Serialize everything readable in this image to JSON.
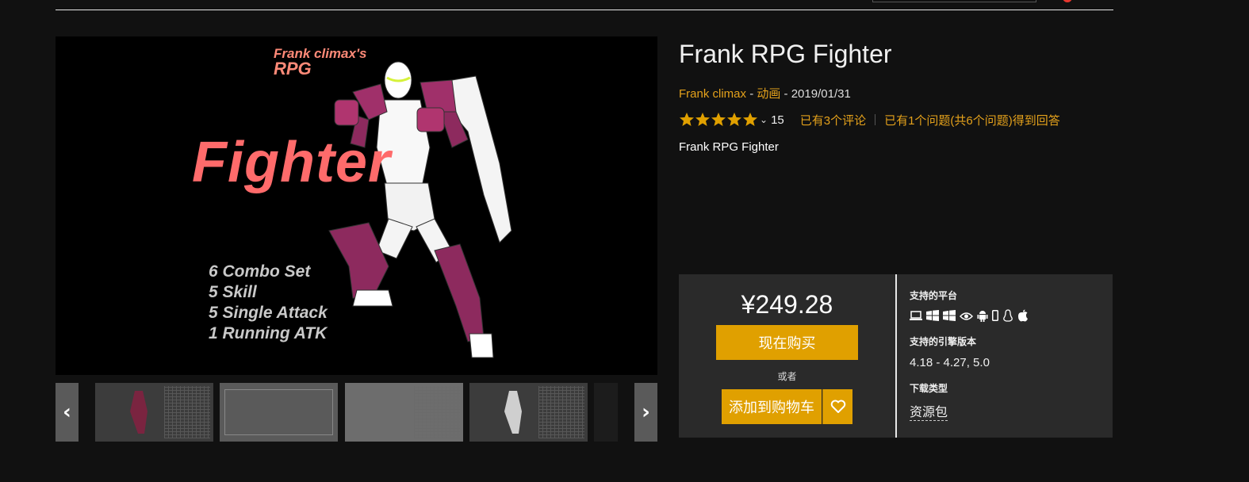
{
  "product": {
    "title": "Frank RPG Fighter",
    "author": "Frank climax",
    "category": "动画",
    "date": "2019/01/31",
    "rating_count": "15",
    "reviews_link": "已有3个评论",
    "questions_link": "已有1个问题(共6个问题)得到回答",
    "description": "Frank RPG Fighter"
  },
  "hero": {
    "subtitle_line1": "Frank climax's",
    "subtitle_line2": "RPG",
    "headline": "Fighter",
    "features": [
      "6 Combo Set",
      "5 Skill",
      "5 Single Attack",
      "1 Running ATK"
    ]
  },
  "purchase": {
    "price": "¥249.28",
    "buy_label": "现在购买",
    "or_label": "或者",
    "cart_label": "添加到购物车"
  },
  "specs": {
    "platforms_label": "支持的平台",
    "platform_icons": [
      "laptop-icon",
      "windows-icon",
      "windows-icon",
      "eye-icon",
      "android-icon",
      "phone-icon",
      "linux-icon",
      "apple-icon"
    ],
    "engine_label": "支持的引擎版本",
    "engine_value": "4.18 - 4.27, 5.0",
    "download_label": "下载类型",
    "download_value": "资源包"
  },
  "colors": {
    "accent": "#e0a000",
    "link": "#e4a11b",
    "hero_title": "#ff6b6b"
  }
}
